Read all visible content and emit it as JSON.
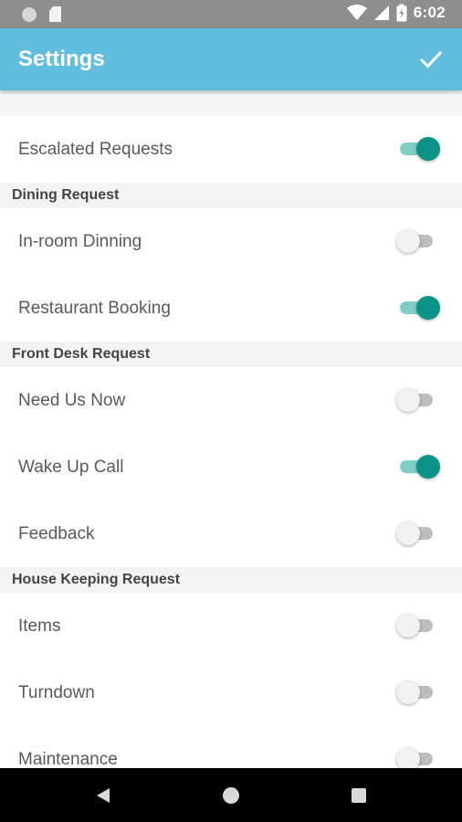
{
  "status_bar": {
    "time": "6:02",
    "left_icons": [
      "circle-notification-icon",
      "sd-card-icon"
    ],
    "right_icons": [
      "wifi-icon",
      "signal-icon",
      "battery-icon"
    ]
  },
  "app_bar": {
    "title": "Settings",
    "confirm_icon": "check-icon"
  },
  "settings": {
    "escalated": {
      "label": "Escalated Requests",
      "enabled": true
    },
    "dining": {
      "header": "Dining Request",
      "items": [
        {
          "label": "In-room Dinning",
          "enabled": false
        },
        {
          "label": "Restaurant Booking",
          "enabled": true
        }
      ]
    },
    "front_desk": {
      "header": "Front Desk Request",
      "items": [
        {
          "label": "Need Us Now",
          "enabled": false
        },
        {
          "label": "Wake Up Call",
          "enabled": true
        },
        {
          "label": "Feedback",
          "enabled": false
        }
      ]
    },
    "house_keeping": {
      "header": "House Keeping Request",
      "items": [
        {
          "label": "Items",
          "enabled": false
        },
        {
          "label": "Turndown",
          "enabled": false
        },
        {
          "label": "Maintenance",
          "enabled": false
        }
      ]
    }
  },
  "colors": {
    "app_bar": "#62bddd",
    "toggle_on": "#0b9486",
    "toggle_on_track": "#7fcfc7",
    "toggle_off_track": "#bdbdbd"
  },
  "nav_bar": {
    "icons": [
      "back-icon",
      "home-icon",
      "recents-icon"
    ]
  }
}
